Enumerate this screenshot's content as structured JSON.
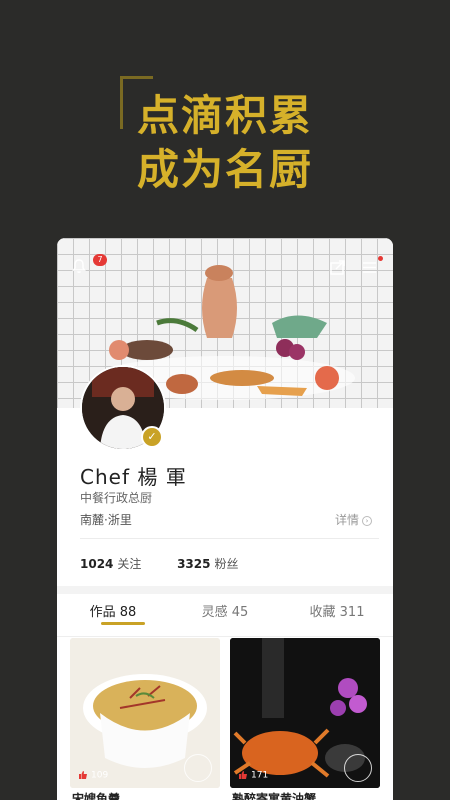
{
  "hero": {
    "line1": "点滴积累",
    "line2": "成为名厨"
  },
  "header": {
    "notification_count": "7"
  },
  "profile": {
    "name": "Chef 楊 軍",
    "title": "中餐行政总厨",
    "location": "南麓·浙里",
    "details_label": "详情"
  },
  "stats": {
    "following_count": "1024",
    "following_label": "关注",
    "followers_count": "3325",
    "followers_label": "粉丝"
  },
  "tabs": [
    {
      "label": "作品 88",
      "active": true
    },
    {
      "label": "灵感 45",
      "active": false
    },
    {
      "label": "收藏 311",
      "active": false
    }
  ],
  "works": [
    {
      "likes": "109",
      "caption": "宋嫂鱼羹"
    },
    {
      "likes": "171",
      "caption": "熟醉寄寓黄油蟹"
    }
  ],
  "colors": {
    "accent": "#c9a226",
    "background": "#2b2b29",
    "badge": "#e53935"
  }
}
